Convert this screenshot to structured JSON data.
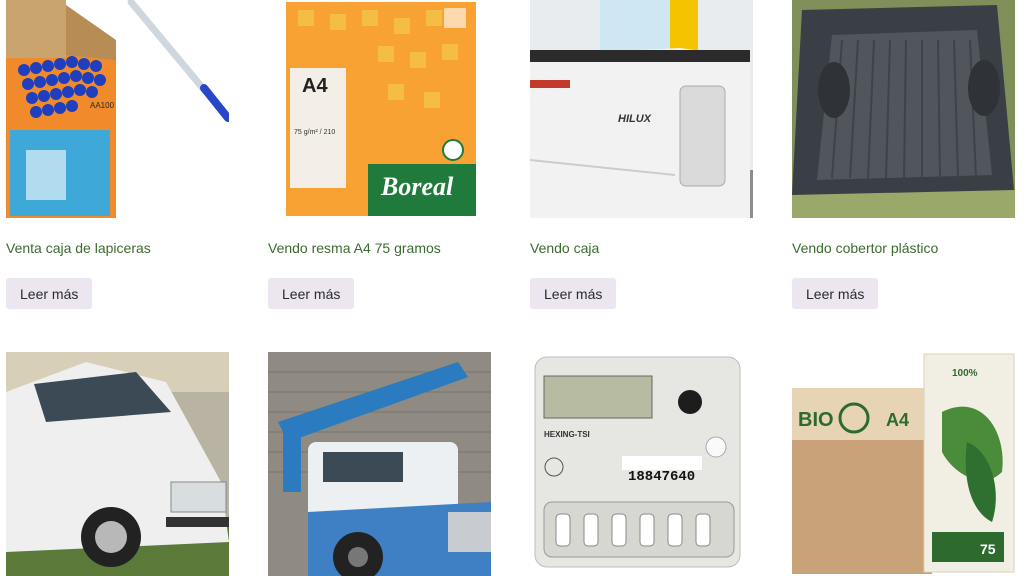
{
  "products": [
    {
      "title": "Venta caja de lapiceras",
      "button": "Leer más"
    },
    {
      "title": "Vendo resma A4 75 gramos",
      "button": "Leer más"
    },
    {
      "title": "Vendo caja",
      "button": "Leer más"
    },
    {
      "title": "Vendo cobertor plástico",
      "button": "Leer más"
    }
  ],
  "image_text": {
    "pen_box_brand": "AA100",
    "paper_size": "A4",
    "paper_weight": "75 g/m² / 210",
    "paper_brand": "Boreal",
    "truck_model": "HILUX",
    "meter_brand": "HEXING-TSI",
    "meter_serial": "18847640",
    "bio_brand": "BIO",
    "bio_size": "A4",
    "bio_percent": "100%",
    "bio_weight": "75"
  }
}
